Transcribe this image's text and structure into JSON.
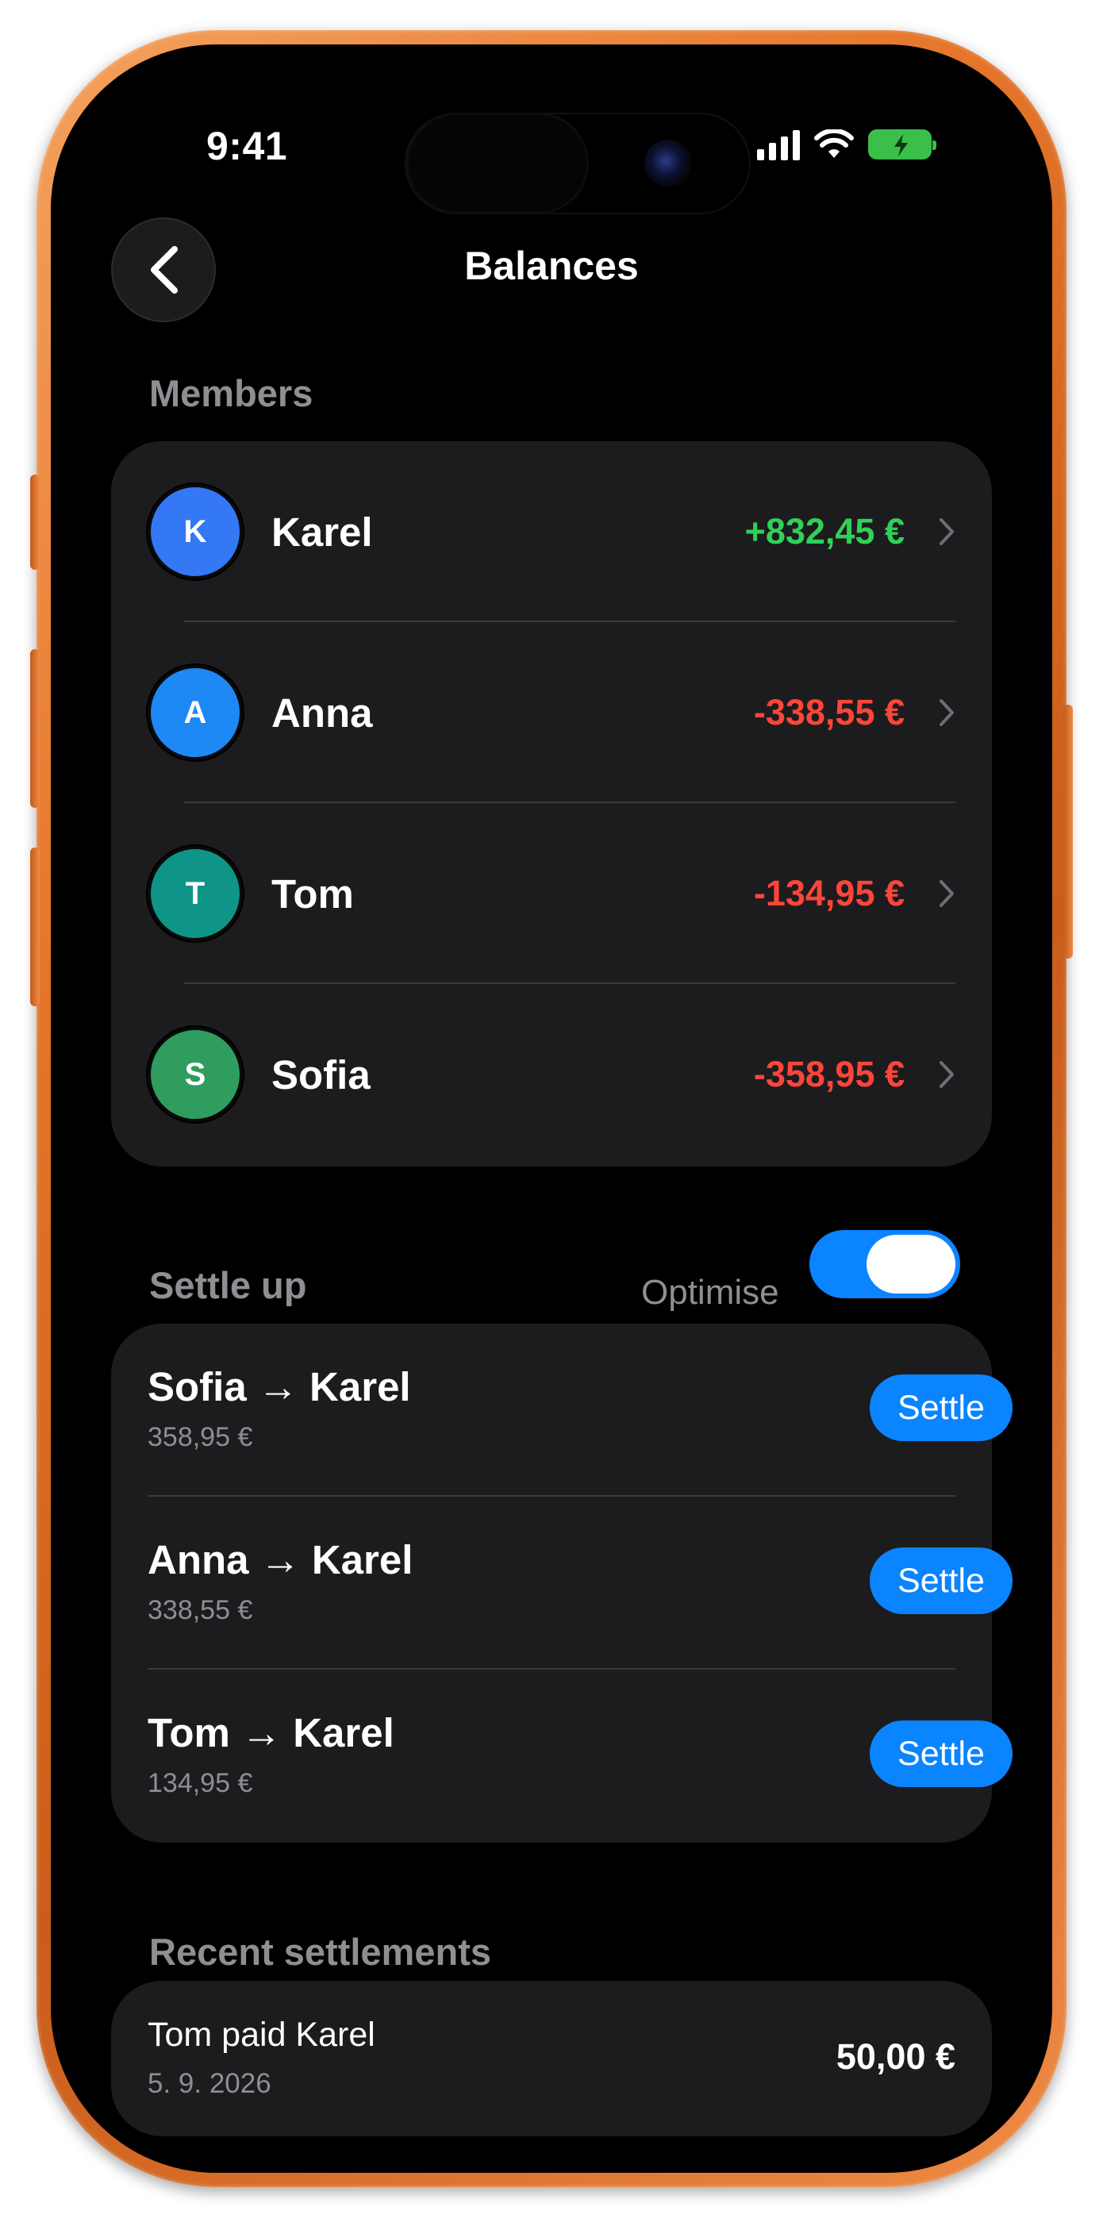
{
  "status_bar": {
    "time": "9:41"
  },
  "header": {
    "title": "Balances"
  },
  "members_section": {
    "label": "Members",
    "items": [
      {
        "initial": "K",
        "name": "Karel",
        "amount": "+832,45 €",
        "avatar_color": "#3478f6",
        "amount_color": "#30d158"
      },
      {
        "initial": "A",
        "name": "Anna",
        "amount": "-338,55 €",
        "avatar_color": "#1e88f5",
        "amount_color": "#ff453a"
      },
      {
        "initial": "T",
        "name": "Tom",
        "amount": "-134,95 €",
        "avatar_color": "#0f9488",
        "amount_color": "#ff453a"
      },
      {
        "initial": "S",
        "name": "Sofia",
        "amount": "-358,95 €",
        "avatar_color": "#2e9d5e",
        "amount_color": "#ff453a"
      }
    ]
  },
  "settle_section": {
    "label": "Settle up",
    "optimise_label": "Optimise",
    "optimise_on": true,
    "items": [
      {
        "title": "Sofia → Karel",
        "amount": "358,95 €",
        "button": "Settle"
      },
      {
        "title": "Anna → Karel",
        "amount": "338,55 €",
        "button": "Settle"
      },
      {
        "title": "Tom → Karel",
        "amount": "134,95 €",
        "button": "Settle"
      }
    ]
  },
  "recent_section": {
    "label": "Recent settlements",
    "items": [
      {
        "title": "Tom paid Karel",
        "date": "5. 9. 2026",
        "amount": "50,00 €"
      }
    ]
  },
  "colors": {
    "accent": "#0a84ff",
    "positive": "#30d158",
    "negative": "#ff453a",
    "frame": "#e5752a"
  }
}
